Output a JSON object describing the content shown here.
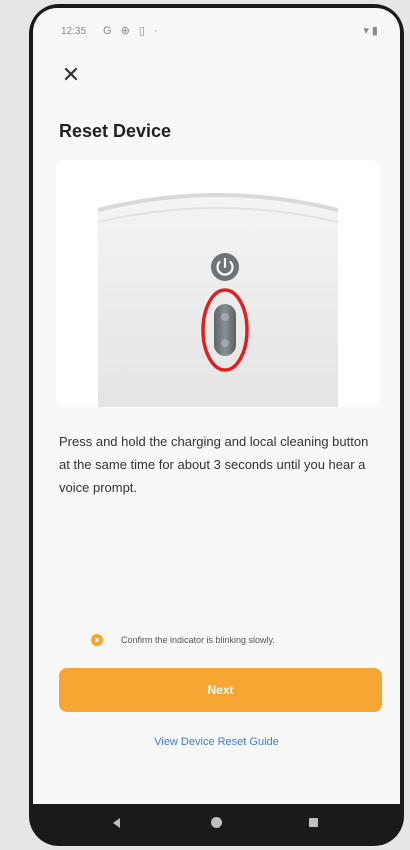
{
  "status_bar": {
    "time": "12:35",
    "icons": "G ⊕ ▯ ·",
    "right_icons": "▾ ▮"
  },
  "close_icon": "close-icon",
  "title": "Reset Device",
  "instruction": "Press and hold the charging and local cleaning button at the same time for about 3 seconds until you hear a voice prompt.",
  "confirm_text": "Confirm the indicator is blinking slowly.",
  "next_label": "Next",
  "guide_link": "View Device Reset Guide",
  "colors": {
    "accent": "#f7a633",
    "link": "#3b7fd6",
    "highlight_ring": "#e02020"
  }
}
